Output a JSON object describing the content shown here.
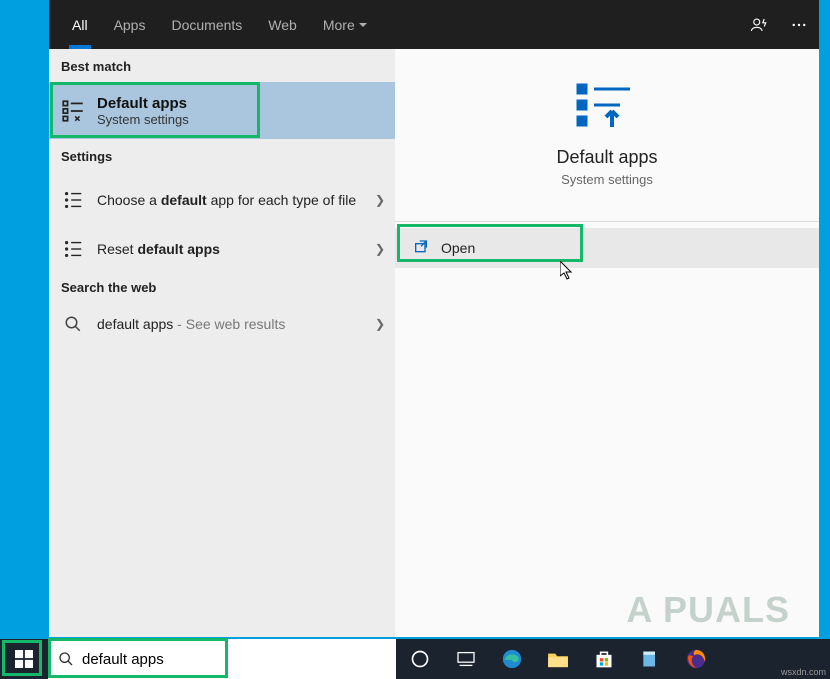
{
  "header": {
    "tabs": {
      "all": "All",
      "apps": "Apps",
      "documents": "Documents",
      "web": "Web",
      "more": "More"
    }
  },
  "sections": {
    "best_match": "Best match",
    "settings": "Settings",
    "search_web": "Search the web"
  },
  "best": {
    "title": "Default apps",
    "sub": "System settings"
  },
  "settings_rows": {
    "each_type_pre": "Choose a ",
    "each_type_bold": "default",
    "each_type_post": " app for each type of file",
    "reset_pre": "Reset ",
    "reset_bold": "default apps"
  },
  "web": {
    "query": "default apps",
    "hint": " - See web results"
  },
  "preview": {
    "title": "Default apps",
    "sub": "System settings",
    "open": "Open"
  },
  "taskbar": {
    "search_value": "default apps"
  },
  "watermark": "A PUALS",
  "src": "wsxdn.com"
}
